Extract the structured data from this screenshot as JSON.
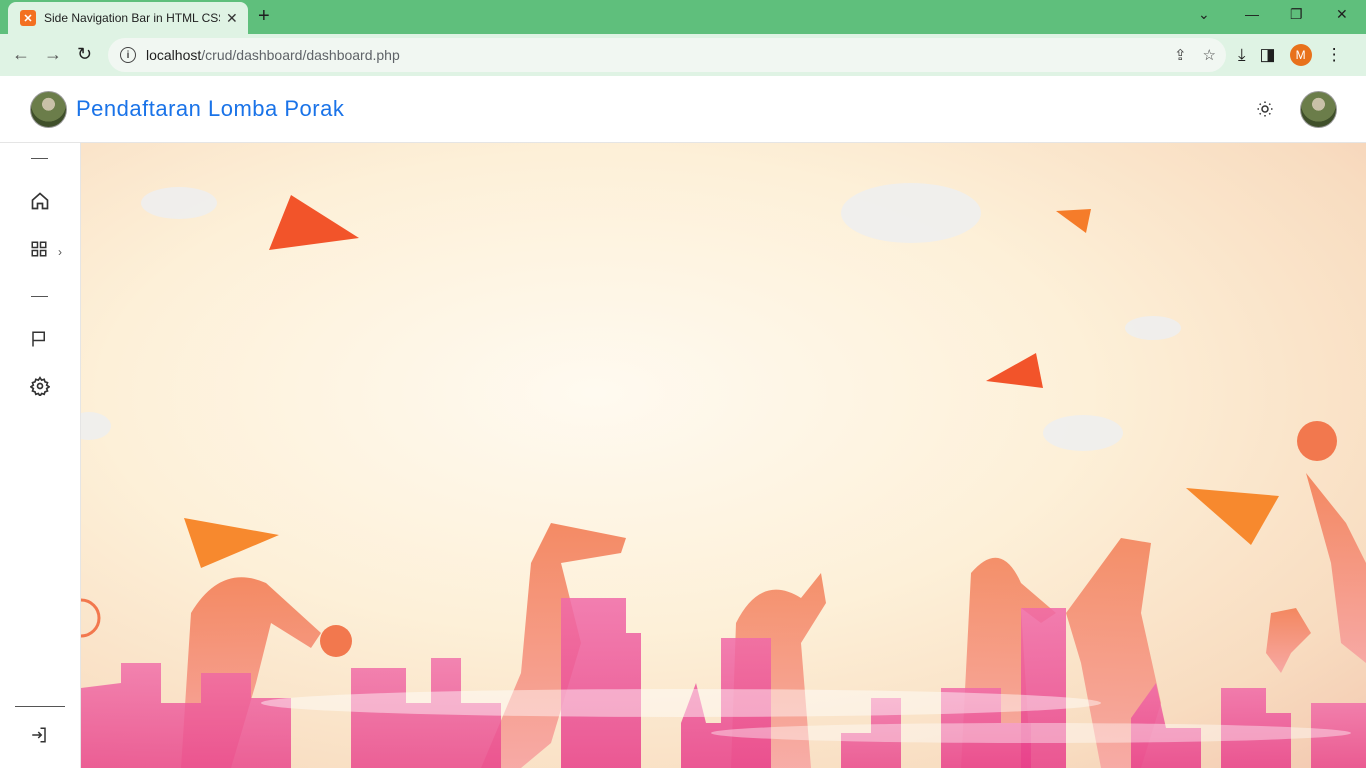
{
  "browser": {
    "tab_title": "Side Navigation Bar in HTML CSS",
    "favicon": "xampp-icon",
    "url_host": "localhost",
    "url_path": "/crud/dashboard/dashboard.php",
    "profile_initial": "M"
  },
  "page": {
    "site_title": "Pendaftaran Lomba Porak",
    "theme_icon": "sun-icon",
    "accent_color": "#1a73e8"
  },
  "sidebar": {
    "items": [
      {
        "name": "home",
        "icon": "home-icon"
      },
      {
        "name": "apps",
        "icon": "grid-icon",
        "has_submenu": true
      },
      {
        "name": "flag",
        "icon": "flag-icon"
      },
      {
        "name": "settings",
        "icon": "gear-icon"
      }
    ],
    "footer_icon": "logout-icon"
  }
}
